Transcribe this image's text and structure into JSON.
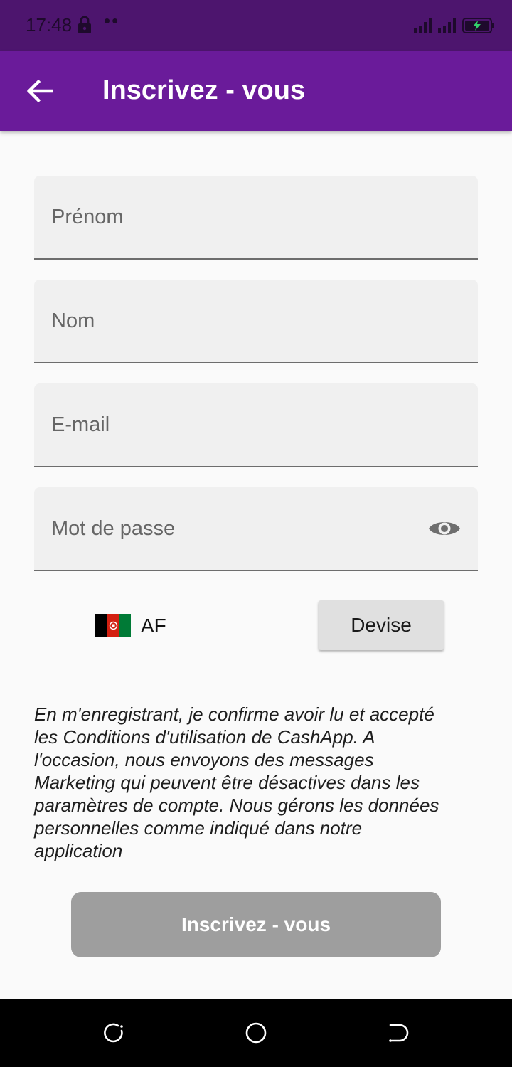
{
  "status_bar": {
    "time": "17:48",
    "notification_dots": "••"
  },
  "app_bar": {
    "title": "Inscrivez - vous",
    "back_icon": "arrow-left-icon",
    "color": "#6a1b9a"
  },
  "form": {
    "first_name": {
      "placeholder": "Prénom",
      "value": ""
    },
    "last_name": {
      "placeholder": "Nom",
      "value": ""
    },
    "email": {
      "placeholder": "E-mail",
      "value": ""
    },
    "password": {
      "placeholder": "Mot de passe",
      "value": "",
      "toggle_icon": "eye-icon"
    }
  },
  "country": {
    "code": "AF",
    "flag_colors": [
      "#000000",
      "#d32011",
      "#007a36"
    ]
  },
  "currency_button": {
    "label": "Devise"
  },
  "terms_text": "En m'enregistrant, je confirme avoir lu et accepté\nles Conditions d'utilisation de CashApp. A\nl'occasion, nous envoyons des messages\nMarketing qui peuvent être désactives  dans les\nparamètres de compte. Nous gérons les données\npersonnelles comme indiqué dans notre\napplication",
  "submit_button": {
    "label": "Inscrivez - vous",
    "color": "#9e9e9e"
  },
  "nav_bar": {
    "recent_icon": "recent-apps-icon",
    "home_icon": "home-icon",
    "back_icon": "back-icon"
  }
}
